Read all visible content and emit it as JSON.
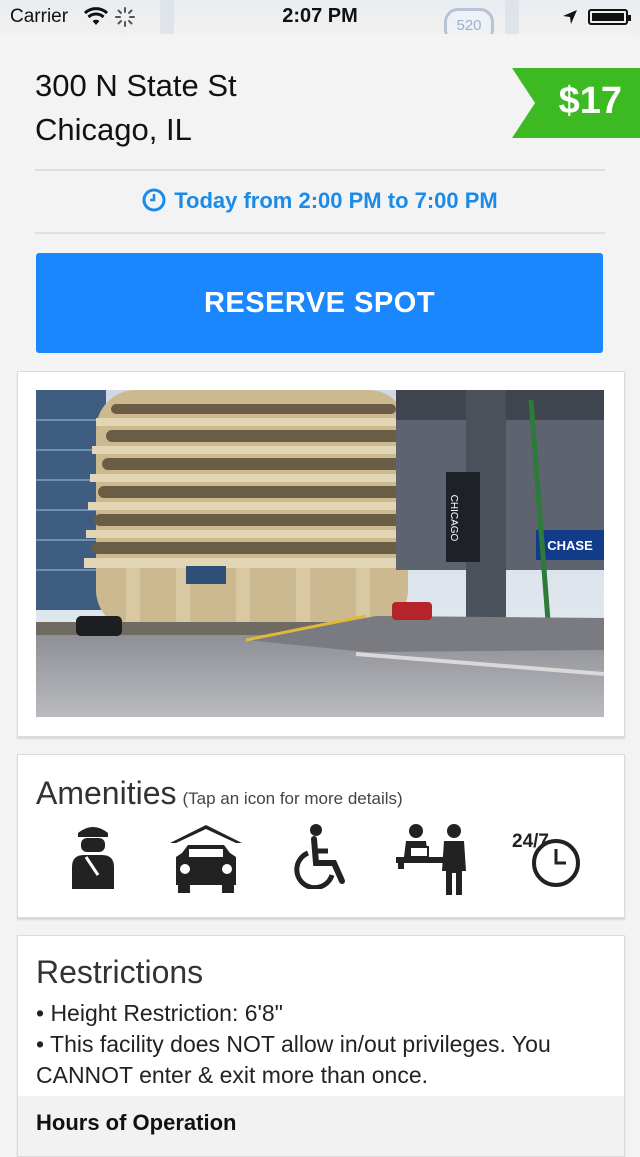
{
  "status_bar": {
    "carrier": "Carrier",
    "time": "2:07 PM",
    "map_shield": "520"
  },
  "listing": {
    "address_line1": "300 N State St",
    "address_line2": "Chicago, IL",
    "price": "$17",
    "time_window": "Today from 2:00 PM to 7:00 PM",
    "reserve_label": "RESERVE SPOT"
  },
  "photo": {
    "sign_text": "CHICAGO",
    "bank_text": "CHASE"
  },
  "amenities": {
    "title": "Amenities",
    "hint": "(Tap an icon for more details)",
    "icons": [
      "valet-icon",
      "covered-parking-icon",
      "wheelchair-accessible-icon",
      "attendant-icon",
      "24-7-icon"
    ],
    "hours_badge": "24/7"
  },
  "restrictions": {
    "title": "Restrictions",
    "items": [
      "• Height Restriction: 6'8\"",
      "• This facility does NOT allow in/out privileges. You CANNOT enter & exit more than once."
    ],
    "hours_heading": "Hours of Operation"
  },
  "colors": {
    "accent_blue": "#1a87ff",
    "time_blue": "#1b8be8",
    "price_green": "#3dba22",
    "background": "#f3f3f3"
  }
}
